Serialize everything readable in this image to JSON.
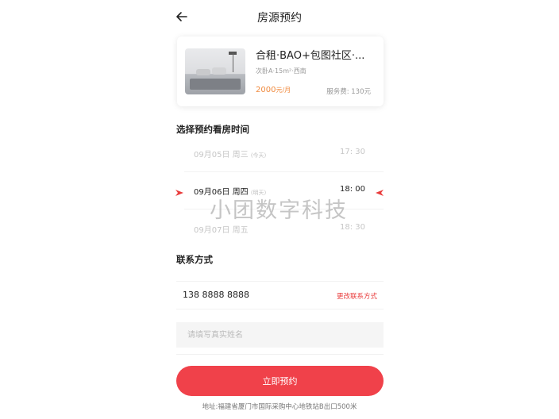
{
  "header": {
    "title": "房源预约",
    "back_icon": "arrow-left-icon"
  },
  "listing": {
    "name": "合租·BAO+包图社区·...",
    "meta": "次卧A·15m²·西南",
    "price": "2000",
    "price_unit": "元/月",
    "fee": "服务费: 130元",
    "price_color": "#f08a3e"
  },
  "schedule": {
    "title": "选择预约看房时间",
    "options": [
      {
        "date": "09月05日",
        "weekday": "周三",
        "tag": "(今天)",
        "time": "17: 30"
      },
      {
        "date": "09月06日",
        "weekday": "周四",
        "tag": "(明天)",
        "time": "18: 00"
      },
      {
        "date": "09月07日",
        "weekday": "周五",
        "tag": "",
        "time": "18: 30"
      }
    ],
    "selected_index": 1,
    "indicator_color": "#e93c3c"
  },
  "contact": {
    "title": "联系方式",
    "phone": "138 8888 8888",
    "change_label": "更改联系方式",
    "name_placeholder": "请填写真实姓名"
  },
  "submit": {
    "label": "立即预约",
    "color": "#f0414a"
  },
  "footer": {
    "address": "地址:福建省厦门市国际采购中心地铁站B出口500米"
  },
  "watermark": "小团数字科技"
}
